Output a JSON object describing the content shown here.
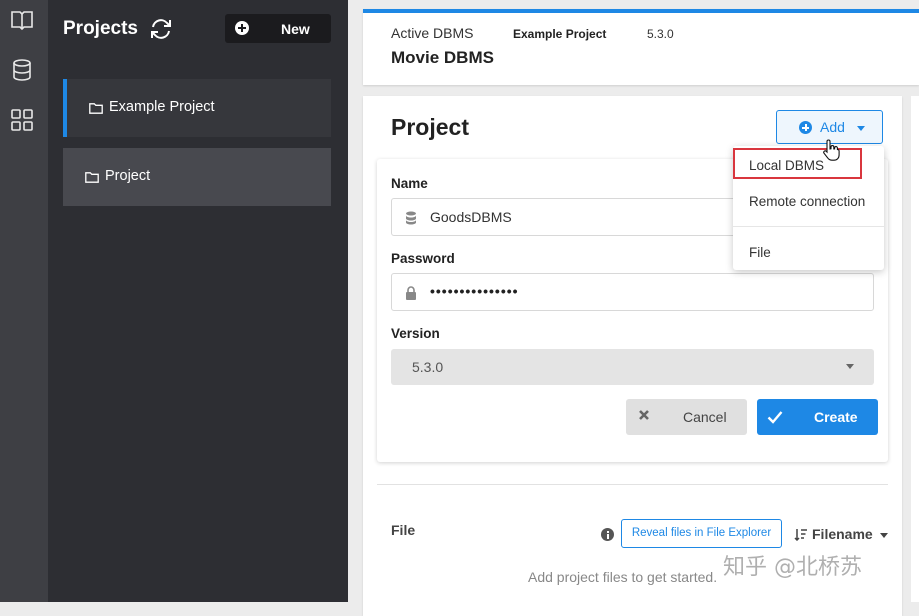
{
  "rail": {
    "icons": [
      "book-open-icon",
      "database-icon",
      "grid-icon"
    ]
  },
  "projects": {
    "title": "Projects",
    "new_label": "New",
    "items": [
      {
        "label": "Example Project",
        "active": true
      },
      {
        "label": "Project",
        "active": false
      }
    ]
  },
  "active_dbms": {
    "label": "Active DBMS",
    "project": "Example Project",
    "version": "5.3.0",
    "name": "Movie DBMS"
  },
  "project_panel": {
    "heading": "Project",
    "add_label": "Add",
    "form": {
      "name_label": "Name",
      "name_value": "GoodsDBMS",
      "password_label": "Password",
      "password_value": "•••••••••••••••",
      "version_label": "Version",
      "version_value": "5.3.0",
      "cancel_label": "Cancel",
      "create_label": "Create"
    },
    "file_label": "File",
    "reveal_label": "Reveal files in File Explorer",
    "sort_label": "Filename",
    "empty_text": "Add project files to get started."
  },
  "add_menu": {
    "items": [
      "Local DBMS",
      "Remote connection",
      "File"
    ]
  },
  "watermark": "知乎 @北桥苏",
  "colors": {
    "accent": "#1e88e5",
    "highlight": "#d9363e",
    "sidebar": "#2d2e33"
  }
}
